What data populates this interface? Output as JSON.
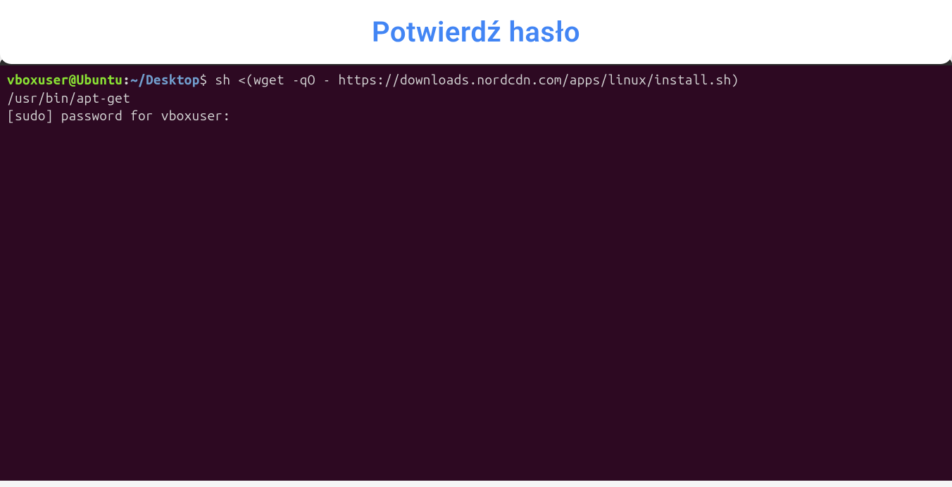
{
  "header": {
    "title": "Potwierdź hasło"
  },
  "terminal": {
    "prompt": {
      "user_host": "vboxuser@Ubuntu",
      "separator": ":",
      "path": "~/Desktop",
      "symbol": "$"
    },
    "command": " sh <(wget -qO - https://downloads.nordcdn.com/apps/linux/install.sh)",
    "output_line_1": "/usr/bin/apt-get",
    "output_line_2": "[sudo] password for vboxuser: "
  }
}
